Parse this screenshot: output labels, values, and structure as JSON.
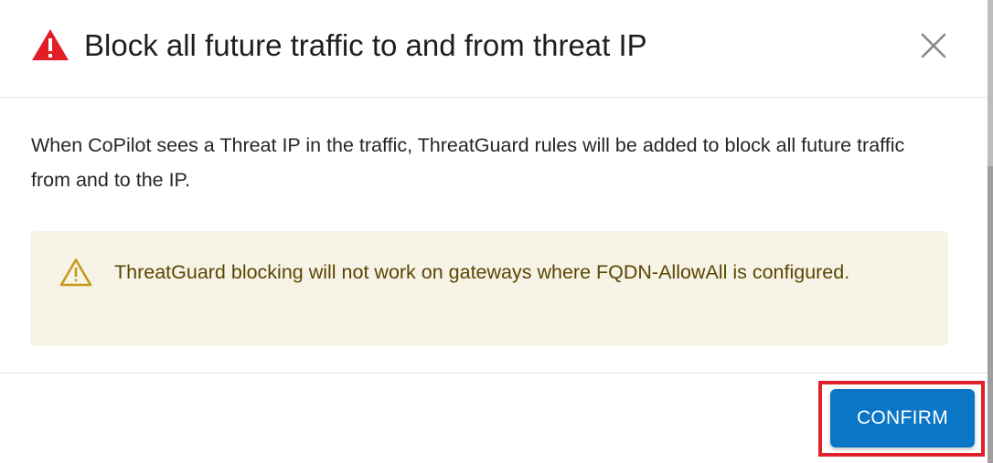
{
  "dialog": {
    "title": "Block all future traffic to and from threat IP",
    "title_icon": "alert-triangle-icon",
    "close_icon": "close-icon",
    "body_text": "When CoPilot sees a Threat IP in the traffic, ThreatGuard rules will be added to block all future traffic from and to the IP.",
    "warning": {
      "icon": "warning-triangle-outline-icon",
      "text": "ThreatGuard blocking will not work on gateways where FQDN-AllowAll is configured."
    },
    "confirm_label": "CONFIRM"
  },
  "colors": {
    "title_icon": "#e11e26",
    "warning_background": "#f7f3e6",
    "warning_icon": "#c79a1a",
    "warning_text": "#5a4500",
    "confirm_button": "#0a76c5",
    "highlight_border": "#e0202a"
  }
}
